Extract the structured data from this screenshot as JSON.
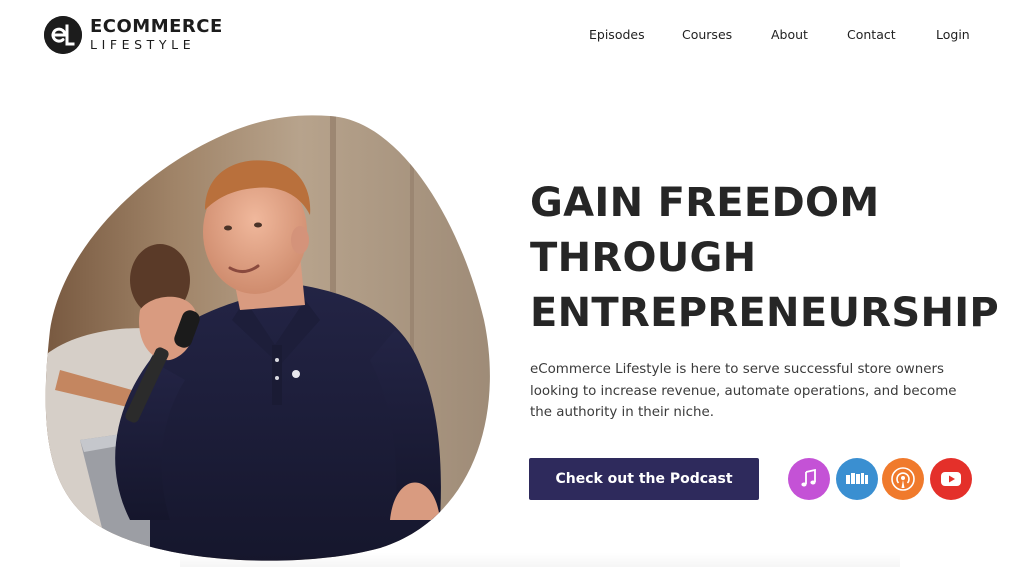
{
  "header": {
    "logo": {
      "line1": "ECOMMERCE",
      "line2": "LIFESTYLE",
      "mark": "EL"
    },
    "nav": [
      {
        "label": "Episodes"
      },
      {
        "label": "Courses"
      },
      {
        "label": "About"
      },
      {
        "label": "Contact"
      },
      {
        "label": "Login"
      }
    ]
  },
  "hero": {
    "headline": [
      "GAIN FREEDOM",
      "THROUGH",
      "ENTREPRENEURSHIP"
    ],
    "description": "eCommerce Lifestyle is here to serve successful store owners looking to increase revenue, automate operations, and become the authority in their niche.",
    "cta_label": "Check out the Podcast",
    "image": "speaker-photo",
    "platforms": [
      {
        "name": "apple-podcasts",
        "icon": "music-note-icon",
        "color": "#c452d6"
      },
      {
        "name": "stitcher",
        "icon": "stitcher-icon",
        "color": "#3a8fd1"
      },
      {
        "name": "overcast",
        "icon": "podcast-broadcast-icon",
        "color": "#f07a2c"
      },
      {
        "name": "youtube",
        "icon": "play-icon",
        "color": "#e4302a"
      }
    ]
  },
  "colors": {
    "cta_background": "#2e2a5c",
    "headline_text": "#262626",
    "body_text": "#3a3a3a",
    "page_background": "#ffffff"
  }
}
